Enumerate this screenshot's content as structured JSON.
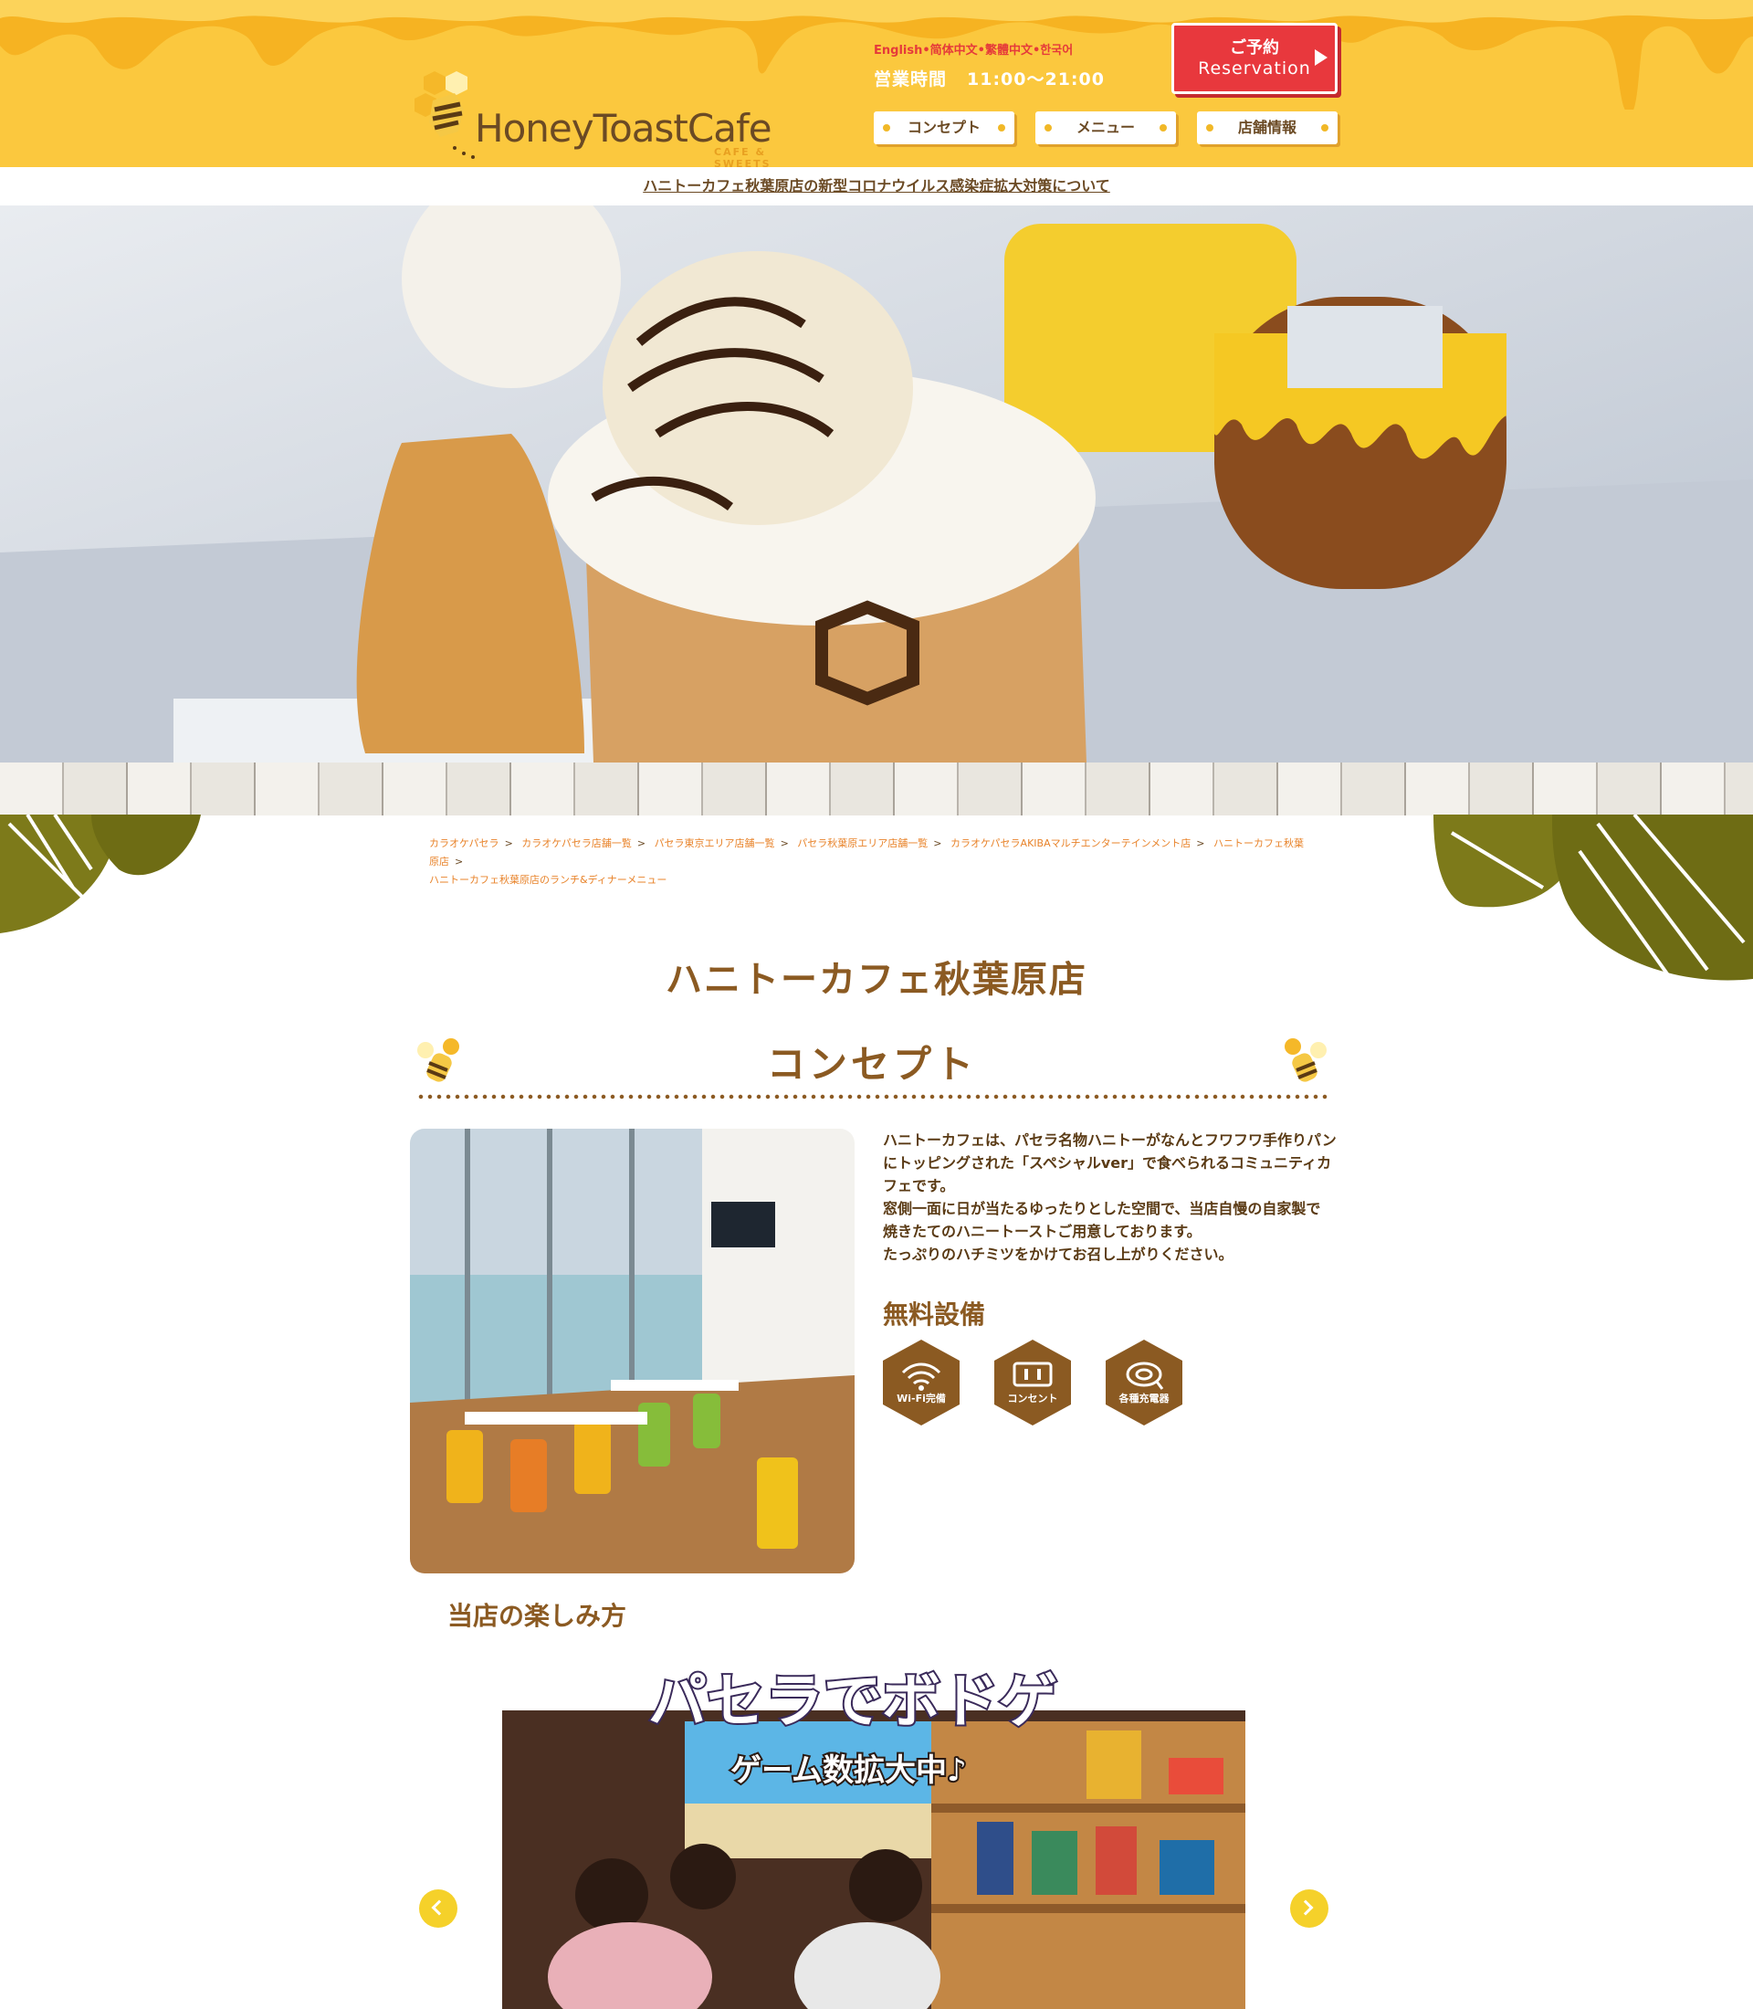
{
  "header": {
    "logo_text": "HoneyToastCafe",
    "logo_sub": "CAFE & SWEETS",
    "languages": "English•简体中文•繁體中文•한국어",
    "hours_label": "営業時間",
    "hours_value": "11:00〜21:00",
    "reserve_jp": "ご予約",
    "reserve_en": "Reservation",
    "nav": [
      "コンセプト",
      "メニュー",
      "店舗情報"
    ]
  },
  "notice": "ハニトーカフェ秋葉原店の新型コロナウイルス感染症拡大対策について",
  "breadcrumb": [
    "カラオケパセラ",
    "カラオケパセラ店舗一覧",
    "パセラ東京エリア店舗一覧",
    "パセラ秋葉原エリア店舗一覧",
    "カラオケパセラAKIBAマルチエンターテインメント店",
    "ハニトーカフェ秋葉原店",
    "ハニトーカフェ秋葉原店のランチ&ディナーメニュー"
  ],
  "page_title": "ハニトーカフェ秋葉原店",
  "concept": {
    "heading": "コンセプト",
    "body": [
      "ハニトーカフェは、パセラ名物ハニトーがなんとフワフワ手作りパン",
      "にトッピングされた「スペシャルver」で食べられるコミュニティカ",
      "フェです。",
      "窓側一面に日が当たるゆったりとした空間で、当店自慢の自家製で",
      "焼きたてのハニートーストご用意しております。",
      "たっぷりのハチミツをかけてお召し上がりください。"
    ],
    "free_heading": "無料設備",
    "amenities": [
      {
        "label": "Wi-Fi完備",
        "icon": "wifi-icon"
      },
      {
        "label": "コンセント",
        "icon": "outlet-icon"
      },
      {
        "label": "各種充電器",
        "icon": "charger-icon"
      }
    ]
  },
  "enjoy_heading": "当店の楽しみ方",
  "slider": {
    "banner_title": "パセラでボドゲ",
    "banner_sub": "ゲーム数拡大中♪"
  },
  "colors": {
    "header_bg": "#fbc83e",
    "brown": "#8b5a22",
    "reserve_red": "#e8383d",
    "accent_orange": "#e8832a"
  }
}
